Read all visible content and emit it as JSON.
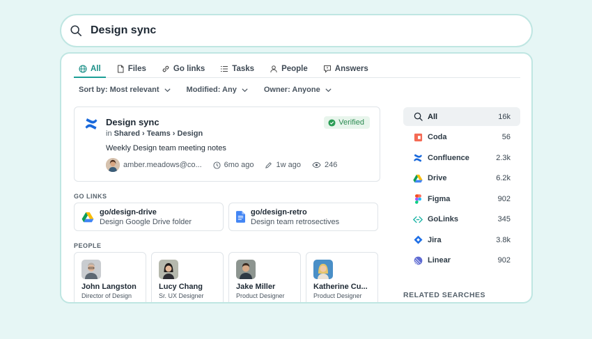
{
  "search": {
    "query": "Design sync"
  },
  "tabs": [
    {
      "label": "All",
      "icon": "globe-icon"
    },
    {
      "label": "Files",
      "icon": "file-icon"
    },
    {
      "label": "Go links",
      "icon": "link-icon"
    },
    {
      "label": "Tasks",
      "icon": "tasks-icon"
    },
    {
      "label": "People",
      "icon": "person-icon"
    },
    {
      "label": "Answers",
      "icon": "answers-icon"
    }
  ],
  "filters": {
    "sort": "Sort by: Most relevant",
    "modified": "Modified: Any",
    "owner": "Owner: Anyone"
  },
  "result": {
    "title": "Design sync",
    "path_prefix": "in",
    "path": "Shared › Teams › Design",
    "verified": "Verified",
    "description": "Weekly Design team meeting notes",
    "owner": "amber.meadows@co...",
    "created": "6mo ago",
    "edited": "1w ago",
    "views": "246"
  },
  "golinks": {
    "label": "GO LINKS",
    "items": [
      {
        "title": "go/design-drive",
        "subtitle": "Design Google Drive folder"
      },
      {
        "title": "go/design-retro",
        "subtitle": "Design team retrosectives"
      }
    ]
  },
  "people": {
    "label": "PEOPLE",
    "items": [
      {
        "name": "John Langston",
        "role": "Director of Design"
      },
      {
        "name": "Lucy Chang",
        "role": "Sr. UX Designer"
      },
      {
        "name": "Jake Miller",
        "role": "Product Designer"
      },
      {
        "name": "Katherine Cu...",
        "role": "Product Designer"
      }
    ]
  },
  "sources": [
    {
      "name": "All",
      "count": "16k"
    },
    {
      "name": "Coda",
      "count": "56"
    },
    {
      "name": "Confluence",
      "count": "2.3k"
    },
    {
      "name": "Drive",
      "count": "6.2k"
    },
    {
      "name": "Figma",
      "count": "902"
    },
    {
      "name": "GoLinks",
      "count": "345"
    },
    {
      "name": "Jira",
      "count": "3.8k"
    },
    {
      "name": "Linear",
      "count": "902"
    }
  ],
  "related_label": "RELATED SEARCHES",
  "colors": {
    "accent": "#1b9e95",
    "border": "#bfe6e2",
    "background": "#e6f6f5"
  }
}
